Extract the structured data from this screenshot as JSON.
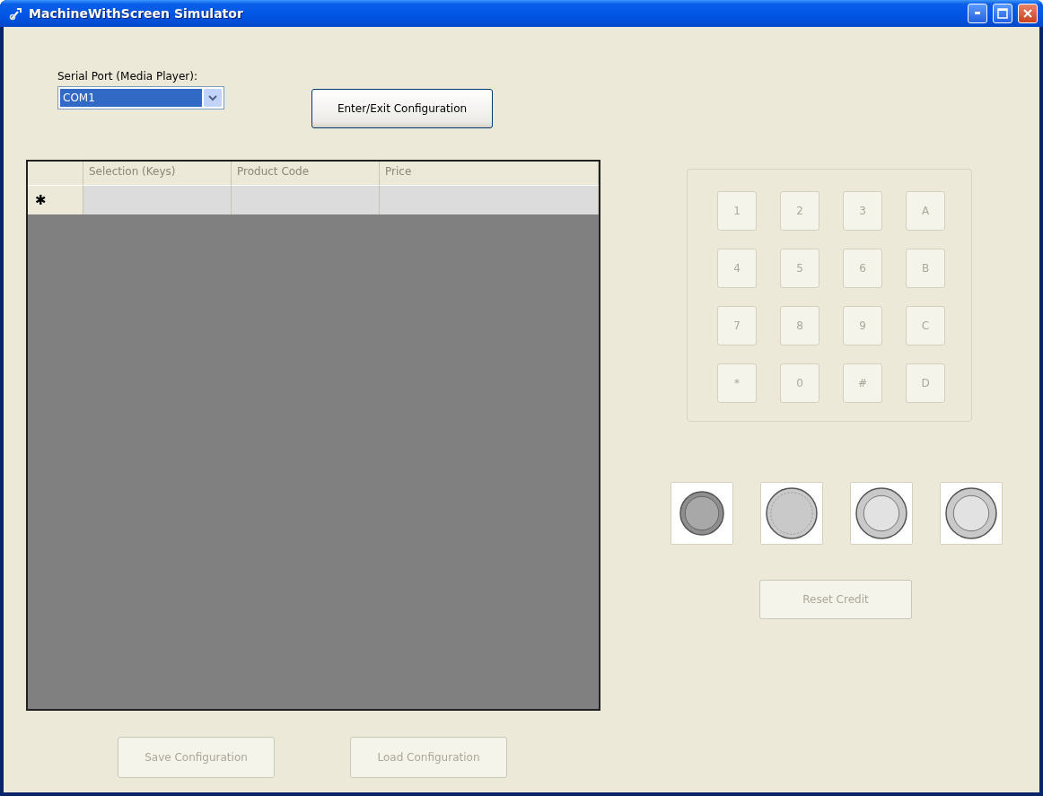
{
  "window": {
    "title": "MachineWithScreen Simulator"
  },
  "serial_port": {
    "label": "Serial Port (Media Player):",
    "value": "COM1"
  },
  "config_button": {
    "label": "Enter/Exit Configuration",
    "disabled": false
  },
  "table": {
    "columns": [
      "Selection (Keys)",
      "Product Code",
      "Price"
    ],
    "new_row_marker": "✱",
    "disabled": true
  },
  "keypad": {
    "keys": [
      {
        "label": "1",
        "disabled": true
      },
      {
        "label": "2",
        "disabled": true
      },
      {
        "label": "3",
        "disabled": true
      },
      {
        "label": "A",
        "disabled": true
      },
      {
        "label": "4",
        "disabled": true
      },
      {
        "label": "5",
        "disabled": true
      },
      {
        "label": "6",
        "disabled": true
      },
      {
        "label": "B",
        "disabled": true
      },
      {
        "label": "7",
        "disabled": true
      },
      {
        "label": "8",
        "disabled": true
      },
      {
        "label": "9",
        "disabled": true
      },
      {
        "label": "C",
        "disabled": true
      },
      {
        "label": "*",
        "disabled": true
      },
      {
        "label": "0",
        "disabled": true
      },
      {
        "label": "#",
        "disabled": true
      },
      {
        "label": "D",
        "disabled": true
      }
    ]
  },
  "coins": [
    {
      "kind": "small"
    },
    {
      "kind": "large"
    },
    {
      "kind": "bimetal"
    },
    {
      "kind": "bimetal"
    }
  ],
  "reset_button": {
    "label": "Reset Credit",
    "disabled": true
  },
  "bottom_buttons": [
    {
      "label": "Save Configuration",
      "disabled": true
    },
    {
      "label": "Load Configuration",
      "disabled": true
    }
  ]
}
